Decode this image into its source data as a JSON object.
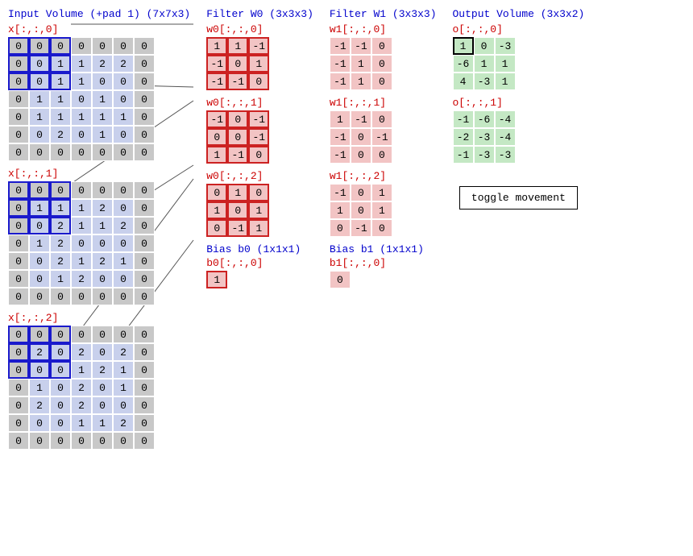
{
  "input": {
    "header": "Input Volume (+pad 1) (7x7x3)",
    "slices": [
      {
        "label": "x[:,:,0]",
        "grid": [
          [
            0,
            0,
            0,
            0,
            0,
            0,
            0
          ],
          [
            0,
            0,
            1,
            1,
            2,
            2,
            0
          ],
          [
            0,
            0,
            1,
            1,
            0,
            0,
            0
          ],
          [
            0,
            1,
            1,
            0,
            1,
            0,
            0
          ],
          [
            0,
            1,
            1,
            1,
            1,
            1,
            0
          ],
          [
            0,
            0,
            2,
            0,
            1,
            0,
            0
          ],
          [
            0,
            0,
            0,
            0,
            0,
            0,
            0
          ]
        ]
      },
      {
        "label": "x[:,:,1]",
        "grid": [
          [
            0,
            0,
            0,
            0,
            0,
            0,
            0
          ],
          [
            0,
            1,
            1,
            1,
            2,
            0,
            0
          ],
          [
            0,
            0,
            2,
            1,
            1,
            2,
            0
          ],
          [
            0,
            1,
            2,
            0,
            0,
            0,
            0
          ],
          [
            0,
            0,
            2,
            1,
            2,
            1,
            0
          ],
          [
            0,
            0,
            1,
            2,
            0,
            0,
            0
          ],
          [
            0,
            0,
            0,
            0,
            0,
            0,
            0
          ]
        ]
      },
      {
        "label": "x[:,:,2]",
        "grid": [
          [
            0,
            0,
            0,
            0,
            0,
            0,
            0
          ],
          [
            0,
            2,
            0,
            2,
            0,
            2,
            0
          ],
          [
            0,
            0,
            0,
            1,
            2,
            1,
            0
          ],
          [
            0,
            1,
            0,
            2,
            0,
            1,
            0
          ],
          [
            0,
            2,
            0,
            2,
            0,
            0,
            0
          ],
          [
            0,
            0,
            0,
            1,
            1,
            2,
            0
          ],
          [
            0,
            0,
            0,
            0,
            0,
            0,
            0
          ]
        ]
      }
    ],
    "selected": {
      "row0": 0,
      "col0": 0,
      "size": 3
    }
  },
  "filter_w0": {
    "header": "Filter W0 (3x3x3)",
    "slices": [
      {
        "label": "w0[:,:,0]",
        "grid": [
          [
            1,
            1,
            -1
          ],
          [
            -1,
            0,
            1
          ],
          [
            -1,
            -1,
            0
          ]
        ]
      },
      {
        "label": "w0[:,:,1]",
        "grid": [
          [
            -1,
            0,
            -1
          ],
          [
            0,
            0,
            -1
          ],
          [
            1,
            -1,
            0
          ]
        ]
      },
      {
        "label": "w0[:,:,2]",
        "grid": [
          [
            0,
            1,
            0
          ],
          [
            1,
            0,
            1
          ],
          [
            0,
            -1,
            1
          ]
        ]
      }
    ]
  },
  "filter_w1": {
    "header": "Filter W1 (3x3x3)",
    "slices": [
      {
        "label": "w1[:,:,0]",
        "grid": [
          [
            -1,
            -1,
            0
          ],
          [
            -1,
            1,
            0
          ],
          [
            -1,
            1,
            0
          ]
        ]
      },
      {
        "label": "w1[:,:,1]",
        "grid": [
          [
            1,
            -1,
            0
          ],
          [
            -1,
            0,
            -1
          ],
          [
            -1,
            0,
            0
          ]
        ]
      },
      {
        "label": "w1[:,:,2]",
        "grid": [
          [
            -1,
            0,
            1
          ],
          [
            1,
            0,
            1
          ],
          [
            0,
            -1,
            0
          ]
        ]
      }
    ]
  },
  "bias_b0": {
    "header": "Bias b0 (1x1x1)",
    "label": "b0[:,:,0]",
    "value": 1
  },
  "bias_b1": {
    "header": "Bias b1 (1x1x1)",
    "label": "b1[:,:,0]",
    "value": 0
  },
  "output": {
    "header": "Output Volume (3x3x2)",
    "slices": [
      {
        "label": "o[:,:,0]",
        "grid": [
          [
            1,
            0,
            -3
          ],
          [
            -6,
            1,
            1
          ],
          [
            4,
            -3,
            1
          ]
        ]
      },
      {
        "label": "o[:,:,1]",
        "grid": [
          [
            -1,
            -6,
            -4
          ],
          [
            -2,
            -3,
            -4
          ],
          [
            -1,
            -3,
            -3
          ]
        ]
      }
    ],
    "selected": {
      "slice": 0,
      "row": 0,
      "col": 0
    }
  },
  "button": {
    "label": "toggle movement"
  }
}
